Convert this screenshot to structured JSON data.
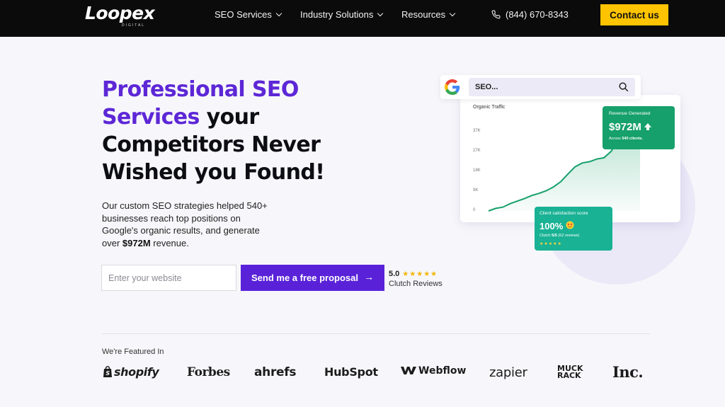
{
  "nav": {
    "logo_text": "Loopex",
    "logo_sub": "DIGITAL",
    "items": [
      {
        "label": "SEO Services"
      },
      {
        "label": "Industry Solutions"
      },
      {
        "label": "Resources"
      }
    ],
    "phone": "(844) 670-8343",
    "contact_label": "Contact us",
    "accent_color": "#ffc400"
  },
  "hero": {
    "title_purple": "Professional SEO Services",
    "title_dark": " your Competitors Never Wished you Found!",
    "desc_main": "Our custom SEO strategies helped 540+ businesses reach top positions on Google's organic results, and generate over ",
    "desc_bold": "$972M",
    "desc_end": " revenue.",
    "input_placeholder": "Enter your website",
    "cta_label": "Send me a free proposal",
    "cta_icon": "arrow-right-icon",
    "brand_color": "#5a22d8",
    "rating_score": "5.0",
    "rating_stars": 5,
    "rating_label": "Clutch Reviews"
  },
  "graphic": {
    "search_text": "SEO...",
    "chart_title": "Organic Traffic",
    "y_ticks": [
      "37K",
      "27K",
      "18K",
      "9K",
      "0"
    ],
    "traffic_values": [
      0,
      1.2,
      1.8,
      3.4,
      4.6,
      5.8,
      7.2,
      8.2,
      9.4,
      11.2,
      13.6,
      17.2,
      20.6,
      22.4,
      23.0,
      24.2,
      24.8,
      27.8,
      33.2,
      36.0,
      35.4,
      36.8
    ],
    "revenue_title": "Revenue Generated",
    "revenue_value": "$972M",
    "revenue_note_pre": "Across ",
    "revenue_note_bold": "540 clients.",
    "satisfaction_title": "Client satisfaction score",
    "satisfaction_value": "100%",
    "satisfaction_note_pre": "Clutch ",
    "satisfaction_note_bold": "5/5",
    "satisfaction_note_end": " (62 reviews)",
    "positive_color": "#16a06b"
  },
  "featured": {
    "label": "We're Featured In",
    "brands": [
      "shopify",
      "Forbes",
      "ahrefs",
      "HubSpot",
      "Webflow",
      "zapier",
      "MUCK RACK",
      "Inc."
    ]
  }
}
